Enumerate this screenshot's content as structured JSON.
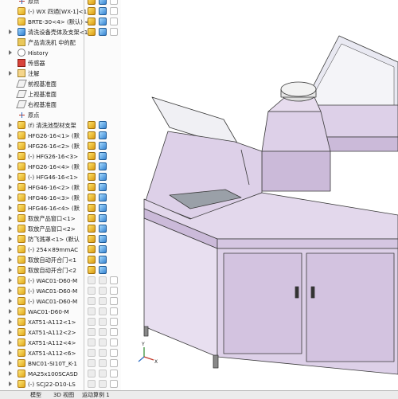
{
  "tree": {
    "items": [
      {
        "label": "原点",
        "icon": "origin-icon",
        "expand": false
      },
      {
        "label": "(-) WX 四通[WX-1]<1>",
        "icon": "part-icon",
        "expand": false
      },
      {
        "label": "BRTE-30<4> (默认) <[",
        "icon": "part-icon",
        "expand": false
      },
      {
        "label": "清洗设备壳体及支架<1",
        "icon": "assembly-icon",
        "expand": true
      },
      {
        "label": "产品清洗机 中的配",
        "icon": "folder-icon",
        "expand": false
      },
      {
        "label": "History",
        "icon": "history-icon",
        "expand": true
      },
      {
        "label": "传感器",
        "icon": "sensor-icon",
        "expand": false
      },
      {
        "label": "注解",
        "icon": "annotation-icon",
        "expand": true
      },
      {
        "label": "前视基准面",
        "icon": "plane-icon",
        "expand": false
      },
      {
        "label": "上视基准面",
        "icon": "plane-icon",
        "expand": false
      },
      {
        "label": "右视基准面",
        "icon": "plane-icon",
        "expand": false
      },
      {
        "label": "原点",
        "icon": "origin-icon",
        "expand": false
      },
      {
        "label": "(f) 清洗池型材支架",
        "icon": "part-icon",
        "expand": true
      },
      {
        "label": "HFG26-16<1> (默",
        "icon": "part-icon",
        "expand": true
      },
      {
        "label": "HFG26-16<2> (默",
        "icon": "part-icon",
        "expand": true
      },
      {
        "label": "(-) HFG26-16<3>",
        "icon": "part-icon",
        "expand": true
      },
      {
        "label": "HFG26-16<4> (默",
        "icon": "part-icon",
        "expand": true
      },
      {
        "label": "(-) HFG46-16<1>",
        "icon": "part-icon",
        "expand": true
      },
      {
        "label": "HFG46-16<2> (默",
        "icon": "part-icon",
        "expand": true
      },
      {
        "label": "HFG46-16<3> (默",
        "icon": "part-icon",
        "expand": true
      },
      {
        "label": "HFG46-16<4> (默",
        "icon": "part-icon",
        "expand": true
      },
      {
        "label": "取放产品窗口<1>",
        "icon": "part-icon",
        "expand": true
      },
      {
        "label": "取放产品窗口<2>",
        "icon": "part-icon",
        "expand": true
      },
      {
        "label": "防飞溅罩<1> (默认",
        "icon": "part-icon",
        "expand": true
      },
      {
        "label": "(-) 254×89mmAC",
        "icon": "part-icon",
        "expand": true
      },
      {
        "label": "取放自动开合门<1",
        "icon": "part-icon",
        "expand": true
      },
      {
        "label": "取放自动开合门<2",
        "icon": "part-icon",
        "expand": true
      },
      {
        "label": "(-) WAC01-D60-M",
        "icon": "part-icon",
        "expand": true
      },
      {
        "label": "(-) WAC01-D60-M",
        "icon": "part-icon",
        "expand": true
      },
      {
        "label": "(-) WAC01-D60-M",
        "icon": "part-icon",
        "expand": true
      },
      {
        "label": "WAC01-D60-M",
        "icon": "part-icon",
        "expand": true
      },
      {
        "label": "XAT51-A112<1>",
        "icon": "part-icon",
        "expand": true
      },
      {
        "label": "XAT51-A112<2>",
        "icon": "part-icon",
        "expand": true
      },
      {
        "label": "XAT51-A112<4>",
        "icon": "part-icon",
        "expand": true
      },
      {
        "label": "XAT51-A112<6>",
        "icon": "part-icon",
        "expand": true
      },
      {
        "label": "BNC01-SI10T_K-1",
        "icon": "part-icon",
        "expand": true
      },
      {
        "label": "MA25x100SCASD",
        "icon": "part-icon",
        "expand": true
      },
      {
        "label": "(-) SCJ22-D10-LS",
        "icon": "part-icon",
        "expand": true
      }
    ]
  },
  "bottom_tabs": [
    "模型",
    "3D 视图",
    "运动算例 1"
  ],
  "axes": {
    "x": "X",
    "y": "Y"
  },
  "colors": {
    "panel": "#ddd0e8",
    "panel_dark": "#cbbad9",
    "frame": "#3a3a3a",
    "glass": "#e6e6f0",
    "tree_bg": "#fbfbfb"
  }
}
